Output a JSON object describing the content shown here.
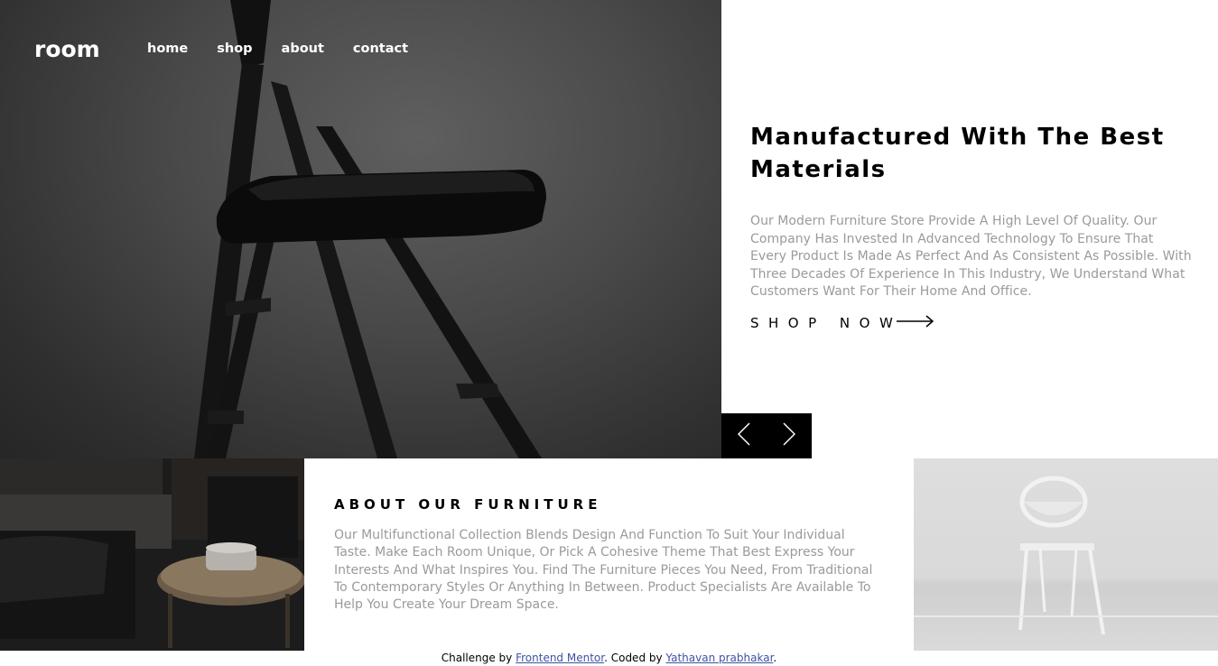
{
  "header": {
    "logo": "room",
    "nav": [
      "home",
      "shop",
      "about",
      "contact"
    ]
  },
  "hero": {
    "title": "Manufactured With The Best Materials",
    "description": "Our Modern Furniture Store Provide A High Level Of Quality. Our Company Has Invested In Advanced Technology To Ensure That Every Product Is Made As Perfect And As Consistent As Possible. With Three Decades Of Experience In This Industry, We Understand What Customers Want For Their Home And Office.",
    "cta": "SHOP NOW",
    "cta_icon": "arrow-right-icon"
  },
  "slider": {
    "prev_icon": "chevron-left-icon",
    "next_icon": "chevron-right-icon"
  },
  "about": {
    "title": "ABOUT OUR FURNITURE",
    "description": "Our Multifunctional Collection Blends Design And Function To Suit Your Individual Taste. Make Each Room Unique, Or Pick A Cohesive Theme That Best Express Your Interests And What Inspires You. Find The Furniture Pieces You Need, From Traditional To Contemporary Styles Or Anything In Between. Product Specialists Are Available To Help You Create Your Dream Space."
  },
  "attribution": {
    "prefix": "Challenge by ",
    "link1": "Frontend Mentor",
    "middle": ". Coded by ",
    "link2": "Yathavan prabhakar",
    "suffix": "."
  },
  "colors": {
    "text_primary": "#000000",
    "text_secondary": "#9a9a9a",
    "link": "#3e52a3",
    "slider_bg": "#000000"
  }
}
